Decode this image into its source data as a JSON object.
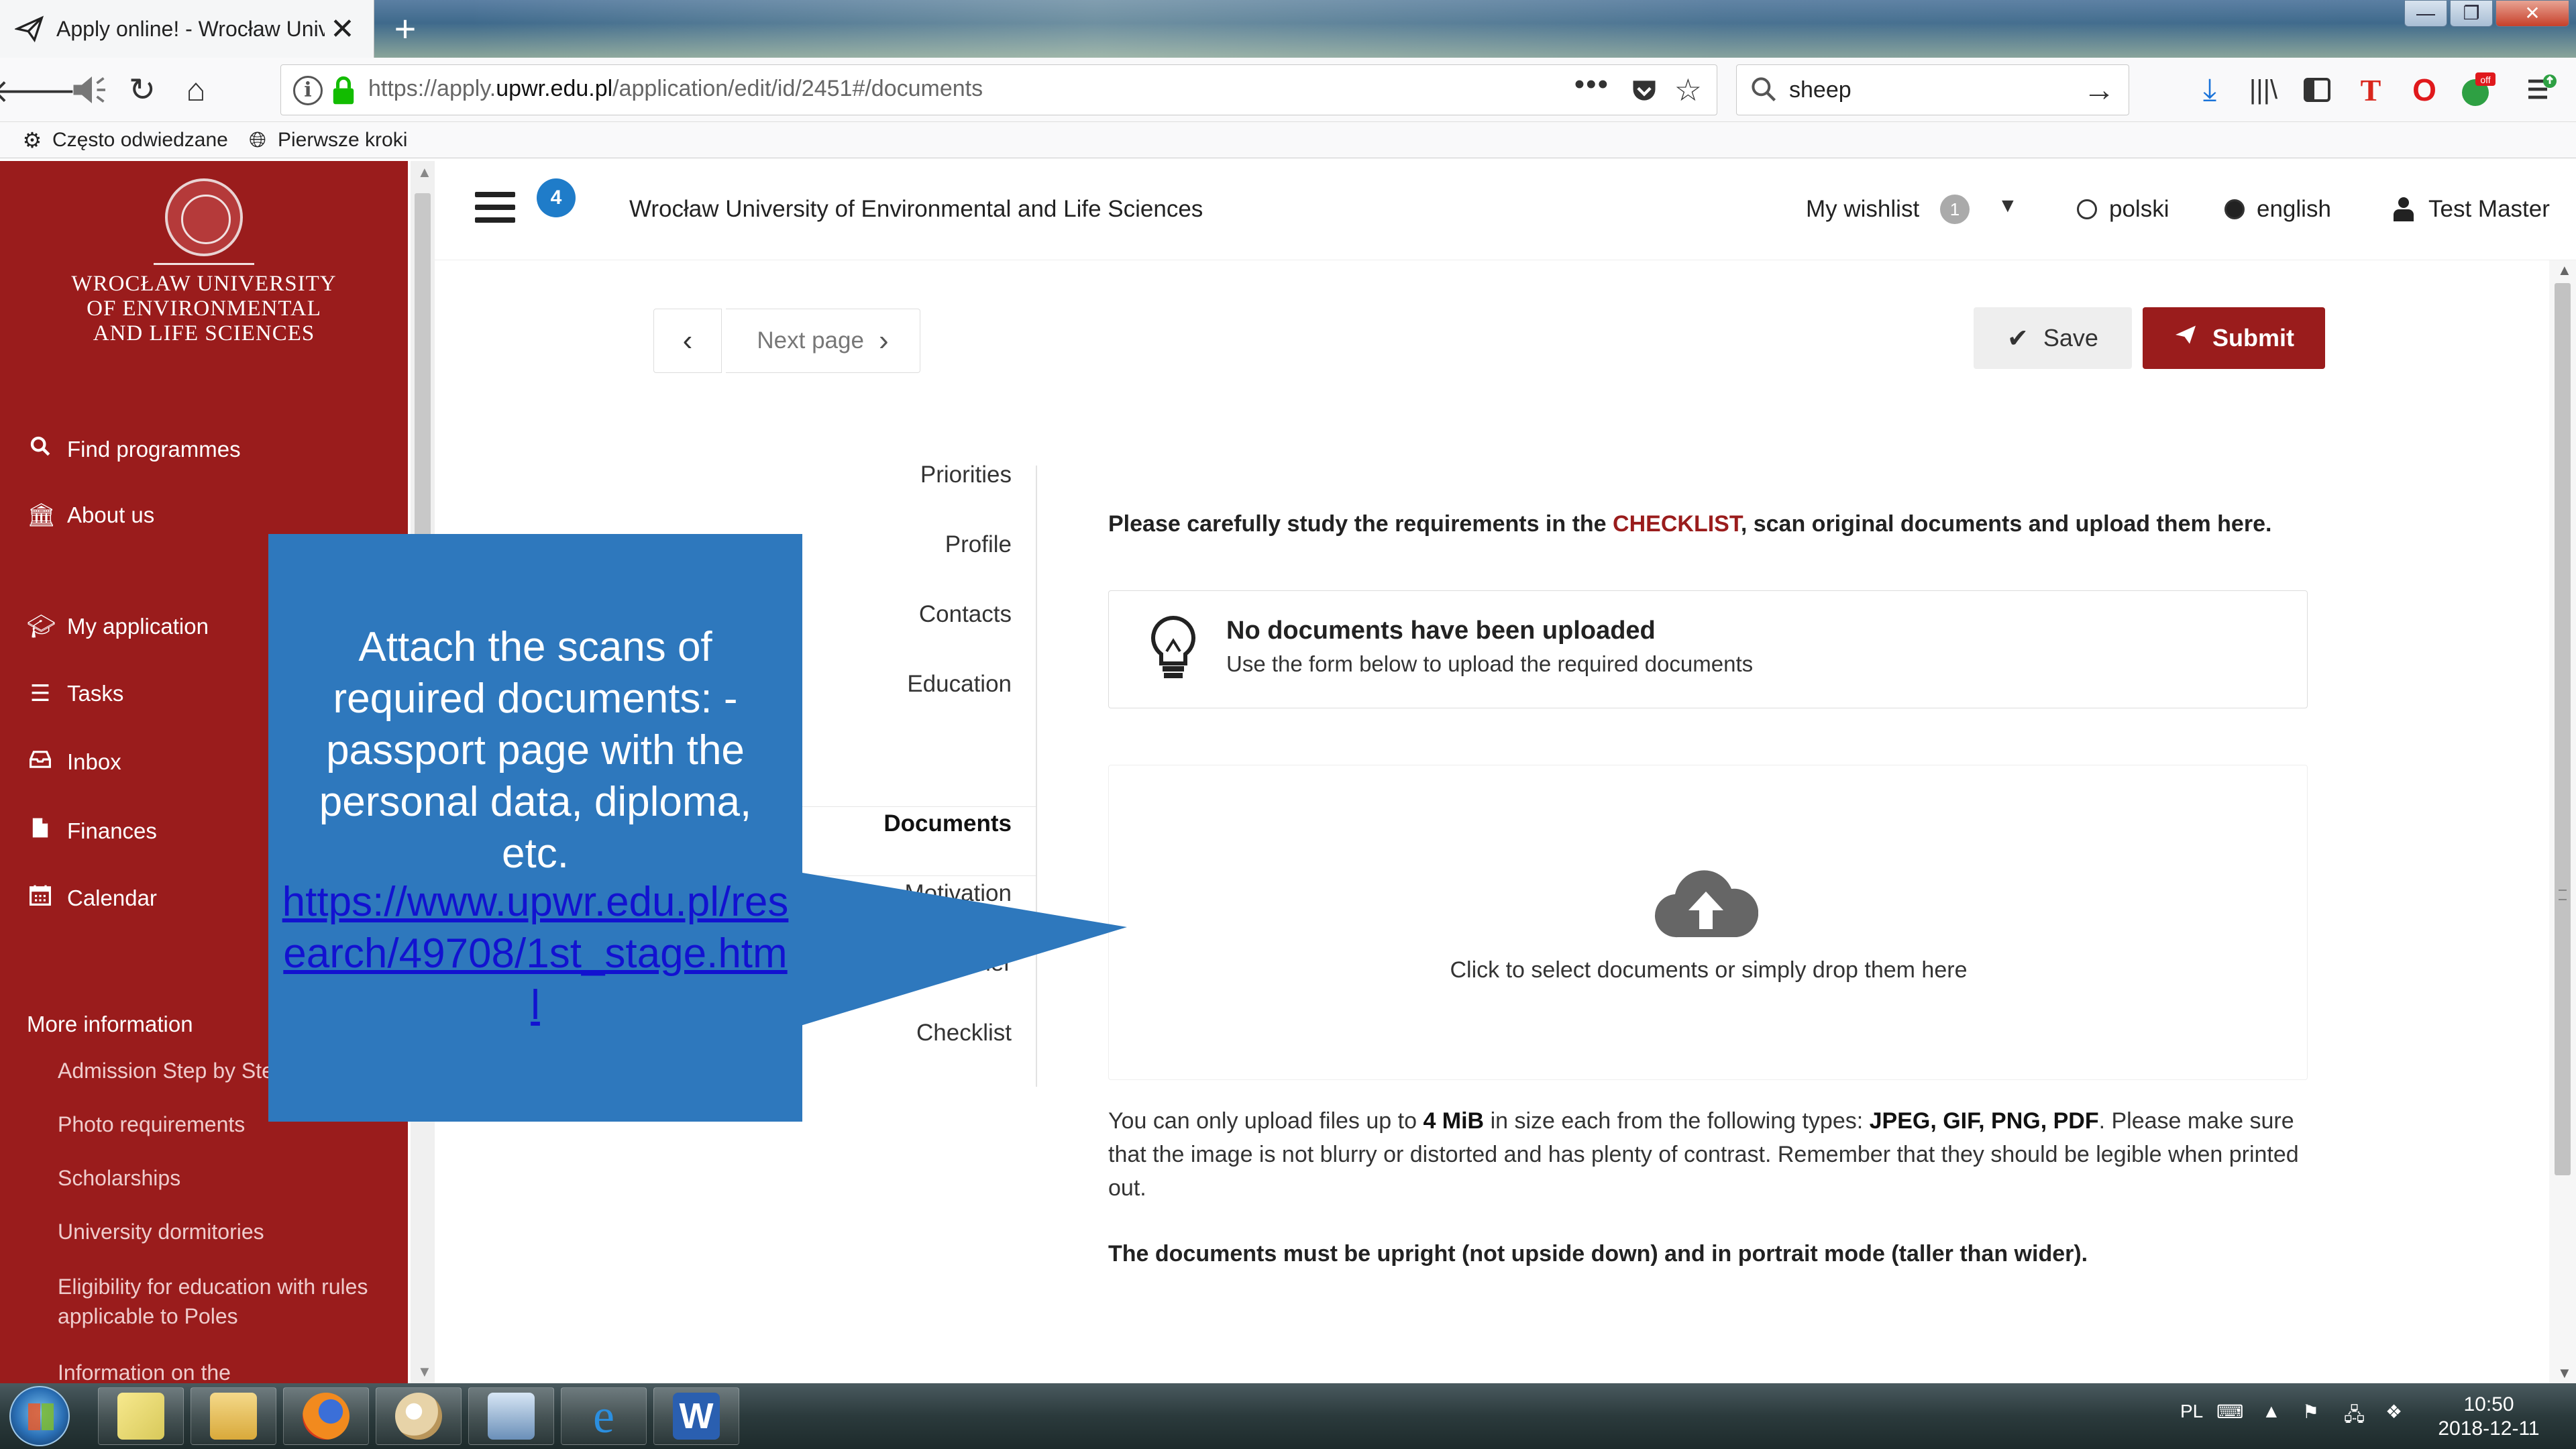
{
  "browser": {
    "tab_title": "Apply online! - Wrocław Unive",
    "tab_close": "✕",
    "new_tab": "+",
    "url_host_prefix": "https://apply.",
    "url_host": "upwr.edu.pl",
    "url_path": "/application/edit/id/2451#/documents",
    "search_value": "sheep",
    "bookmarks": [
      {
        "label": "Często odwiedzane",
        "icon": "gear-icon"
      },
      {
        "label": "Pierwsze kroki",
        "icon": "globe-icon"
      }
    ],
    "window_buttons": {
      "minimize": "—",
      "maximize": "❐",
      "close": "✕"
    }
  },
  "sidebar": {
    "university_name": [
      "Wrocław University",
      "of Environmental",
      "and Life Sciences"
    ],
    "nav": [
      {
        "label": "Find programmes",
        "icon": "search-icon"
      },
      {
        "label": "About us",
        "icon": "building-icon"
      },
      {
        "label": "My application",
        "icon": "graduation-cap-icon"
      },
      {
        "label": "Tasks",
        "icon": "list-icon"
      },
      {
        "label": "Inbox",
        "icon": "inbox-icon"
      },
      {
        "label": "Finances",
        "icon": "file-icon"
      },
      {
        "label": "Calendar",
        "icon": "calendar-icon"
      }
    ],
    "more_title": "More information",
    "more_links": [
      "Admission Step by Step",
      "Photo requirements",
      "Scholarships",
      "University dormitories",
      "Eligibility for education with rules applicable to Poles",
      "Information on the"
    ]
  },
  "header": {
    "badge_count": "4",
    "title": "Wrocław University of Environmental and Life Sciences",
    "wishlist_label": "My wishlist",
    "wishlist_count": "1",
    "languages": [
      {
        "label": "polski",
        "selected": false
      },
      {
        "label": "english",
        "selected": true
      }
    ],
    "user_name": "Test Master"
  },
  "toolbar": {
    "prev_icon": "‹",
    "next_label": "Next page",
    "next_icon": "›",
    "save_label": "Save",
    "submit_label": "Submit"
  },
  "steps": [
    {
      "label": "Priorities",
      "active": false
    },
    {
      "label": "Profile",
      "active": false
    },
    {
      "label": "Contacts",
      "active": false
    },
    {
      "label": "Education",
      "active": false
    },
    {
      "label": "Documents",
      "active": true
    },
    {
      "label": "Motivation",
      "active": false
    },
    {
      "label": "Other",
      "active": false
    },
    {
      "label": "Checklist",
      "active": false
    }
  ],
  "documents": {
    "intro_before": "Please carefully study the requirements in the ",
    "intro_highlight": "CHECKLIST",
    "intro_after": ", scan original documents and upload them here.",
    "alert_title": "No documents have been uploaded",
    "alert_sub": "Use the form below to upload the required documents",
    "drop_text": "Click to select documents or simply drop them here",
    "info_1": "You can only upload files up to ",
    "info_size": "4 MiB",
    "info_2": " in size each from the following types: ",
    "info_types": "JPEG, GIF, PNG, PDF",
    "info_3": ". Please make sure that the image is not blurry or distorted and has plenty of contrast. Remember that they should be legible when printed out.",
    "info_bold": "The documents must be upright (not upside down) and in portrait mode (taller than wider)."
  },
  "callout": {
    "text": "Attach the scans of required documents: -passport page with the personal data, diploma, etc.",
    "link": "https://www.upwr.edu.pl/research/49708/1st_stage.html"
  },
  "taskbar": {
    "lang": "PL",
    "time": "10:50",
    "date": "2018-12-11"
  },
  "colors": {
    "brand": "#9a1c1c",
    "callout": "#2e78bd",
    "badge": "#1f7cc9"
  }
}
